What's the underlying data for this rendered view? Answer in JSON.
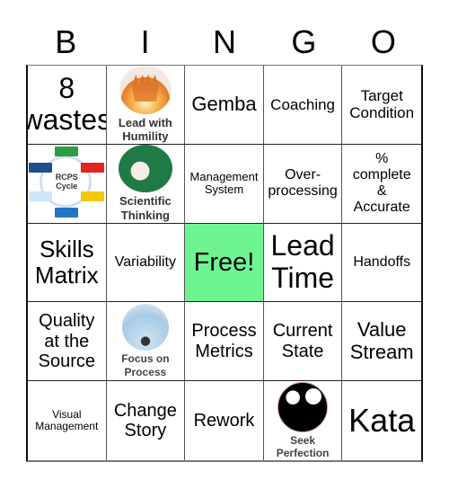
{
  "header": {
    "letters": [
      "B",
      "I",
      "N",
      "G",
      "O"
    ]
  },
  "cells": [
    {
      "text": "8\nwastes",
      "lines": [
        "8",
        "wastes"
      ]
    },
    {
      "image": "people-celebrating-icon",
      "caption": [
        "Lead with",
        "Humility"
      ]
    },
    {
      "lines": [
        "Gemba"
      ]
    },
    {
      "lines": [
        "Coaching"
      ]
    },
    {
      "lines": [
        "Target",
        "Condition"
      ]
    },
    {
      "image": "rcps-cycle-diagram",
      "diagram_label": [
        "RCPS",
        "Cycle"
      ]
    },
    {
      "image": "scientist-icon",
      "caption": [
        "Scientific",
        "Thinking"
      ]
    },
    {
      "lines": [
        "Management",
        "System"
      ]
    },
    {
      "lines": [
        "Over-",
        "processing"
      ]
    },
    {
      "lines": [
        "%",
        "complete",
        "&",
        "Accurate"
      ]
    },
    {
      "lines": [
        "Skills",
        "Matrix"
      ]
    },
    {
      "lines": [
        "Variability"
      ]
    },
    {
      "lines": [
        "Free!"
      ],
      "free": true
    },
    {
      "lines": [
        "Lead",
        "Time"
      ]
    },
    {
      "lines": [
        "Handoffs"
      ]
    },
    {
      "lines": [
        "Quality",
        "at the",
        "Source"
      ]
    },
    {
      "image": "process-focus-icon",
      "caption": [
        "Focus on",
        "Process"
      ]
    },
    {
      "lines": [
        "Process",
        "Metrics"
      ]
    },
    {
      "lines": [
        "Current",
        "State"
      ]
    },
    {
      "lines": [
        "Value",
        "Stream"
      ]
    },
    {
      "lines": [
        "Visual",
        "Management"
      ]
    },
    {
      "lines": [
        "Change",
        "Story"
      ]
    },
    {
      "lines": [
        "Rework"
      ]
    },
    {
      "image": "perfect-score-paddles-icon",
      "caption": [
        "Seek",
        "Perfection"
      ]
    },
    {
      "lines": [
        "Kata"
      ]
    }
  ],
  "colors": {
    "free_cell": "#6ef592"
  }
}
